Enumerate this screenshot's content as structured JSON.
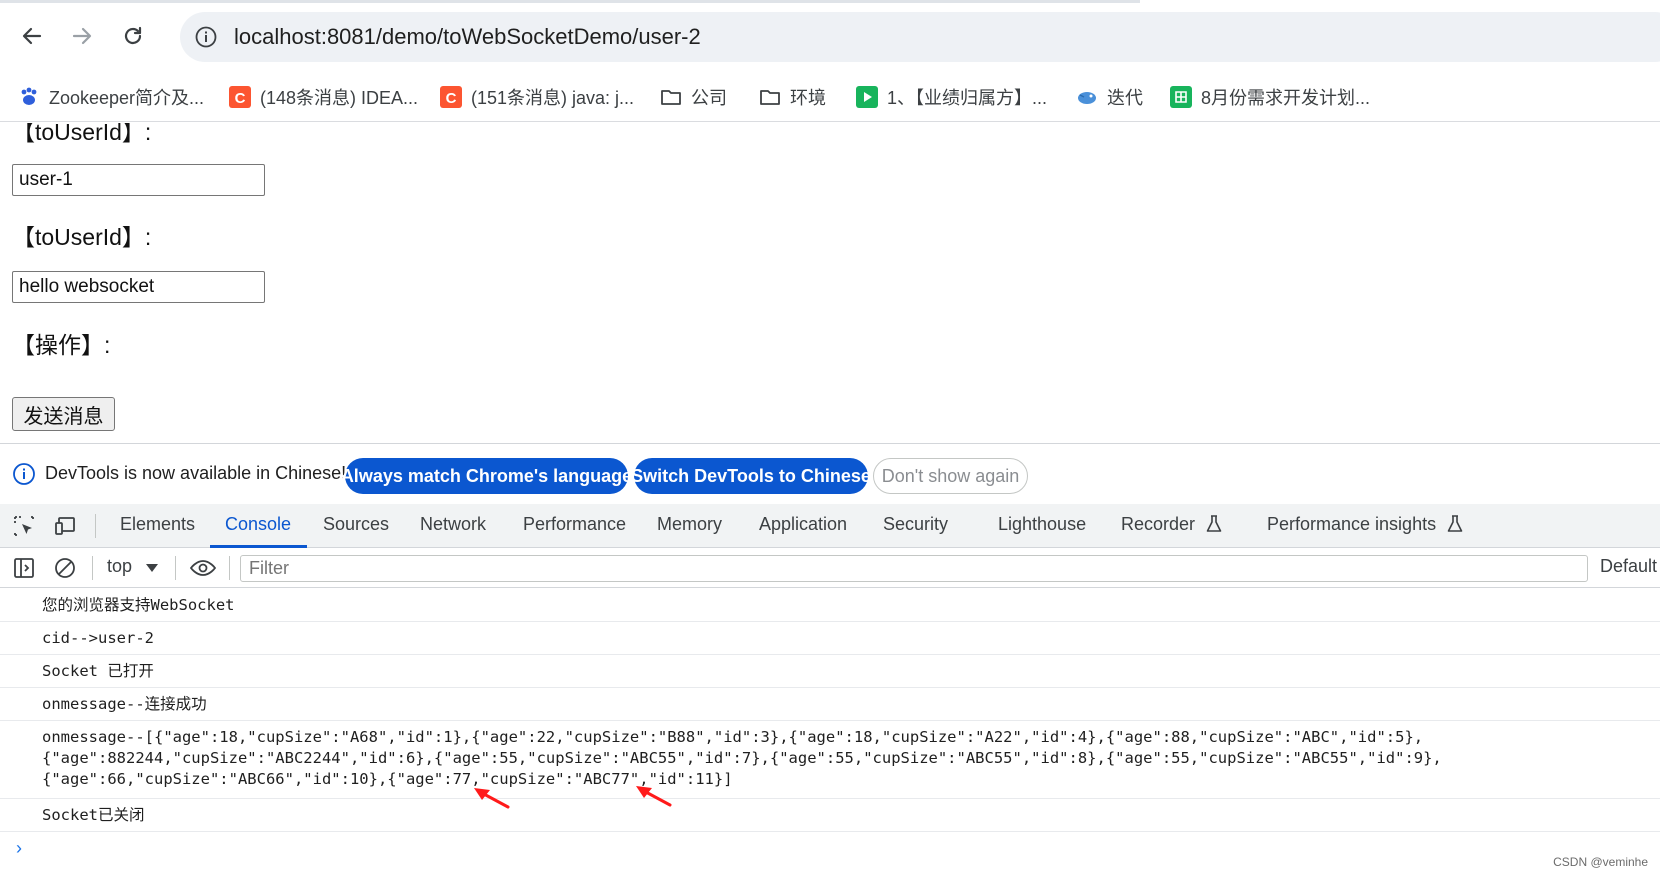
{
  "browser": {
    "url": "localhost:8081/demo/toWebSocketDemo/user-2",
    "bookmarks": [
      {
        "label": "Zookeeper简介及...",
        "icon": "baidu-paw-icon"
      },
      {
        "label": "(148条消息) IDEA...",
        "icon": "csdn-icon"
      },
      {
        "label": "(151条消息) java: j...",
        "icon": "csdn-icon"
      },
      {
        "label": "公司",
        "icon": "folder-icon"
      },
      {
        "label": "环境",
        "icon": "folder-icon"
      },
      {
        "label": "1、【业绩归属方】...",
        "icon": "video-play-icon"
      },
      {
        "label": "迭代",
        "icon": "bird-icon"
      },
      {
        "label": "8月份需求开发计划...",
        "icon": "sheet-icon"
      }
    ]
  },
  "page": {
    "label_top": "【toUserId】:",
    "input_to_user": "user-1",
    "label_msg": "【toUserId】:",
    "input_msg": "hello websocket",
    "label_action": "【操作】:",
    "send_button": "发送消息"
  },
  "devtools": {
    "infobar_message": "DevTools is now available in Chinese!",
    "btn_always_match": "Always match Chrome's language",
    "btn_switch": "Switch DevTools to Chinese",
    "btn_dont_show": "Don't show again",
    "tabs": [
      "Elements",
      "Console",
      "Sources",
      "Network",
      "Performance",
      "Memory",
      "Application",
      "Security",
      "Lighthouse",
      "Recorder",
      "Performance insights"
    ],
    "active_tab": "Console",
    "context": "top",
    "filter_placeholder": "Filter",
    "levels": "Default levels",
    "logs": [
      "您的浏览器支持WebSocket",
      "cid-->user-2",
      "Socket 已打开",
      "onmessage--连接成功",
      "onmessage--[{\"age\":18,\"cupSize\":\"A68\",\"id\":1},{\"age\":22,\"cupSize\":\"B88\",\"id\":3},{\"age\":18,\"cupSize\":\"A22\",\"id\":4},{\"age\":88,\"cupSize\":\"ABC\",\"id\":5},\n{\"age\":882244,\"cupSize\":\"ABC2244\",\"id\":6},{\"age\":55,\"cupSize\":\"ABC55\",\"id\":7},{\"age\":55,\"cupSize\":\"ABC55\",\"id\":8},{\"age\":55,\"cupSize\":\"ABC55\",\"id\":9},\n{\"age\":66,\"cupSize\":\"ABC66\",\"id\":10},{\"age\":77,\"cupSize\":\"ABC77\",\"id\":11}]",
      "Socket已关闭"
    ]
  },
  "watermark": "CSDN @veminhe",
  "colors": {
    "accent": "#0b57d0",
    "annotation_arrow": "#ff1a1a"
  }
}
